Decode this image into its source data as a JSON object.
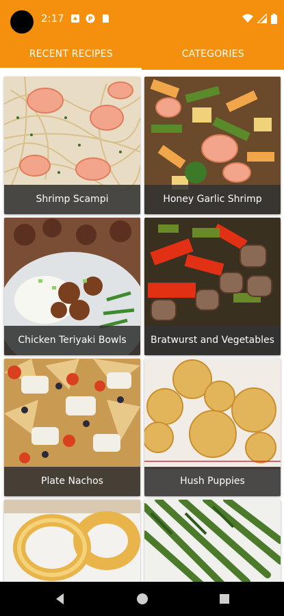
{
  "status_bar": {
    "time": "2:17"
  },
  "tabs": [
    {
      "label": "RECENT RECIPES"
    },
    {
      "label": "CATEGORIES"
    }
  ],
  "recipes": [
    {
      "title": "Shrimp Scampi"
    },
    {
      "title": "Honey Garlic Shrimp"
    },
    {
      "title": "Chicken Teriyaki Bowls"
    },
    {
      "title": "Bratwurst and Vegetables"
    },
    {
      "title": "Plate Nachos"
    },
    {
      "title": "Hush Puppies"
    },
    {
      "title": ""
    },
    {
      "title": ""
    }
  ],
  "colors": {
    "app_bar": "#f5900f",
    "caption_bg": "#323232"
  },
  "nav_icons": [
    "back-icon",
    "home-icon",
    "recents-icon"
  ]
}
